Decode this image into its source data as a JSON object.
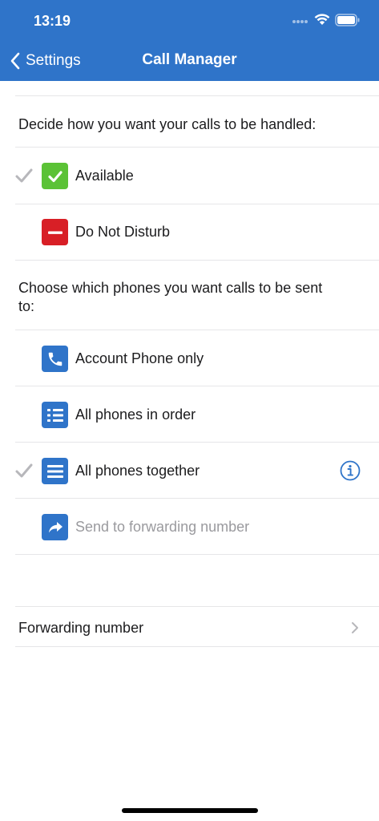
{
  "status_bar": {
    "time": "13:19",
    "icons": [
      "cellular-dots-icon",
      "wifi-icon",
      "battery-icon"
    ]
  },
  "nav": {
    "back_label": "Settings",
    "title": "Call Manager"
  },
  "colors": {
    "header": "#2f74c9",
    "available": "#5bc236",
    "dnd": "#d81f26",
    "icon_blue": "#2f74c9",
    "check": "#b7b7bb"
  },
  "status_section": {
    "title": "Decide how you want your calls to be handled:",
    "options": [
      {
        "label": "Available",
        "selected": true,
        "icon": "check-square-icon"
      },
      {
        "label": "Do Not Disturb",
        "selected": false,
        "icon": "minus-square-icon"
      }
    ]
  },
  "phones_section": {
    "title": "Choose which phones you want calls to be sent to:",
    "options": [
      {
        "label": "Account Phone only",
        "selected": false,
        "icon": "phone-icon",
        "disabled": false
      },
      {
        "label": "All phones in order",
        "selected": false,
        "icon": "ordered-list-icon",
        "disabled": false
      },
      {
        "label": "All phones together",
        "selected": true,
        "icon": "list-icon",
        "disabled": false,
        "info": "info-icon"
      },
      {
        "label": "Send to forwarding number",
        "selected": false,
        "icon": "forward-arrow-icon",
        "disabled": true
      }
    ]
  },
  "forwarding": {
    "label": "Forwarding number"
  }
}
